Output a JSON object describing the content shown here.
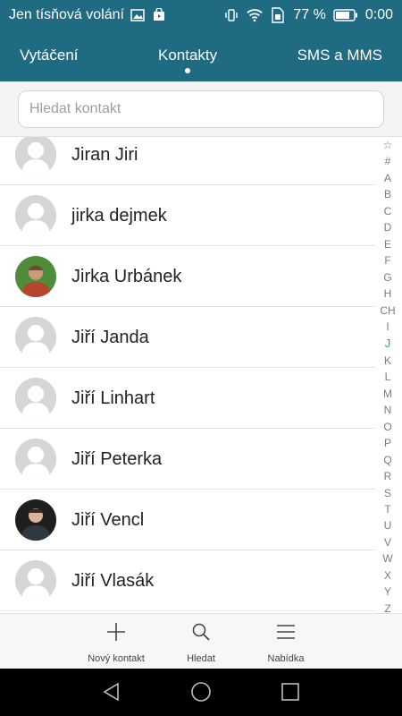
{
  "status_bar": {
    "carrier_text": "Jen tísňová volání",
    "battery_text": "77 %",
    "time": "0:00",
    "icons": [
      "image-icon",
      "store-icon",
      "vibrate-icon",
      "wifi-icon",
      "sim-icon",
      "battery-icon"
    ]
  },
  "tabs": [
    {
      "label": "Vytáčení"
    },
    {
      "label": "Kontakty",
      "active": true
    },
    {
      "label": "SMS a MMS"
    }
  ],
  "search": {
    "placeholder": "Hledat kontakt",
    "value": ""
  },
  "contacts": [
    {
      "name": "Jiran Jiri",
      "avatar": "default"
    },
    {
      "name": "jirka dejmek",
      "avatar": "default"
    },
    {
      "name": "Jirka Urbánek",
      "avatar": "photo-green"
    },
    {
      "name": "Jiří Janda",
      "avatar": "default"
    },
    {
      "name": "Jiří Linhart",
      "avatar": "default"
    },
    {
      "name": "Jiří Peterka",
      "avatar": "default"
    },
    {
      "name": "Jiří Vencl",
      "avatar": "photo-dark"
    },
    {
      "name": "Jiří Vlasák",
      "avatar": "default"
    }
  ],
  "alpha_index": [
    "☆",
    "#",
    "A",
    "B",
    "C",
    "D",
    "E",
    "F",
    "G",
    "H",
    "CH",
    "I",
    "J",
    "K",
    "L",
    "M",
    "N",
    "O",
    "P",
    "Q",
    "R",
    "S",
    "T",
    "U",
    "V",
    "W",
    "X",
    "Y",
    "Z"
  ],
  "alpha_active": "J",
  "actions": {
    "new_contact": "Nový kontakt",
    "search": "Hledat",
    "menu": "Nabídka"
  },
  "colors": {
    "header": "#1f6b82",
    "accent": "#1aa3c4"
  }
}
